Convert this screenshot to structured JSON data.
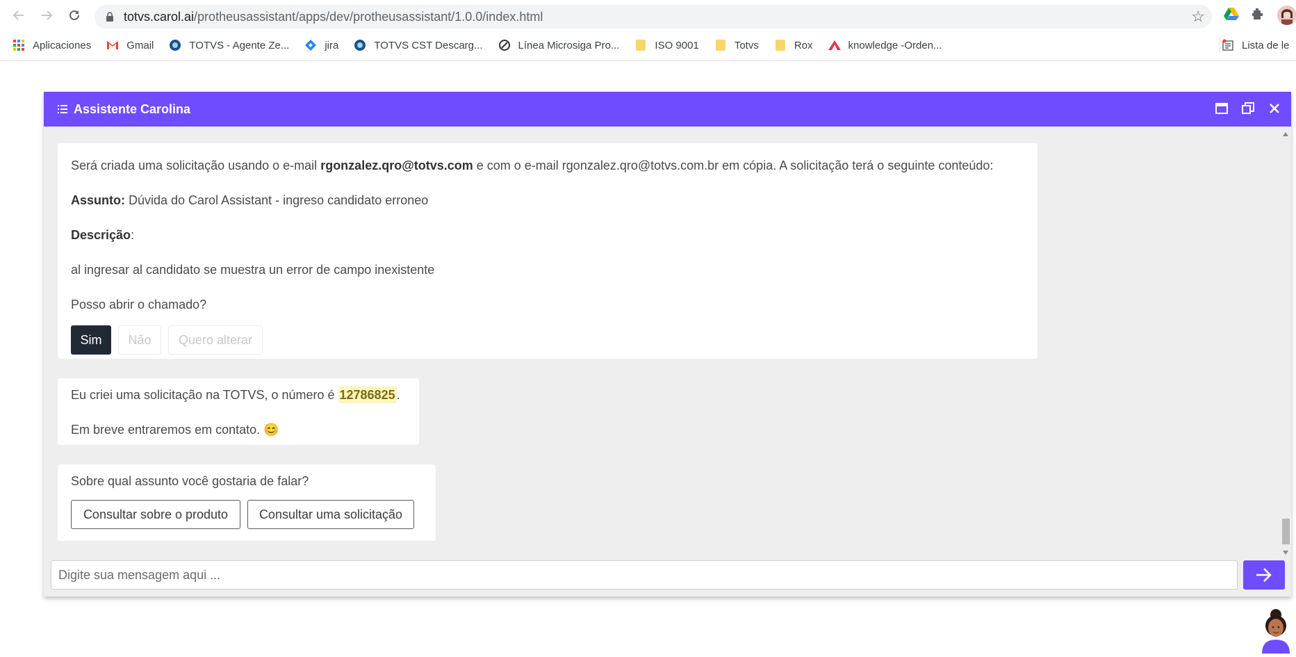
{
  "browser": {
    "url_host": "totvs.carol.ai",
    "url_path": "/protheusassistant/apps/dev/protheusassistant/1.0.0/index.html",
    "bookmarks": [
      {
        "label": "Aplicaciones",
        "icon": "apps-grid-icon"
      },
      {
        "label": "Gmail",
        "icon": "gmail-icon"
      },
      {
        "label": "TOTVS - Agente Ze...",
        "icon": "globe-icon"
      },
      {
        "label": "jira",
        "icon": "jira-icon"
      },
      {
        "label": "TOTVS CST Descarg...",
        "icon": "globe-icon"
      },
      {
        "label": "Línea Microsiga Pro...",
        "icon": "globe-icon"
      },
      {
        "label": "ISO 9001",
        "icon": "folder-icon"
      },
      {
        "label": "Totvs",
        "icon": "folder-icon"
      },
      {
        "label": "Rox",
        "icon": "folder-icon"
      },
      {
        "label": "knowledge -Orden...",
        "icon": "knowledge-icon"
      }
    ],
    "reading_list": "Lista de le"
  },
  "chat": {
    "title": "Assistente Carolina",
    "colors": {
      "accent": "#6f4cff",
      "primary_button": "#212a34",
      "highlight": "#fff6b8"
    },
    "message1": {
      "intro_prefix": "Será criada uma solicitação usando o e-mail ",
      "email": "rgonzalez.qro@totvs.com",
      "intro_suffix": " e com o e-mail rgonzalez.qro@totvs.com.br em cópia. A solicitação terá o seguinte conteúdo:",
      "subject_label": "Assunto:",
      "subject_value": " Dúvida do Carol Assistant - ingreso candidato erroneo",
      "description_label": "Descrição",
      "description_colon": ":",
      "description_value": "al ingresar al candidato se muestra un error de campo inexistente",
      "question": "Posso abrir o chamado?",
      "buttons": {
        "yes": "Sim",
        "no": "Não",
        "change": "Quero alterar"
      }
    },
    "message2": {
      "line1_prefix": "Eu criei uma solicitação na TOTVS, o número é ",
      "ticket_number": "12786825",
      "line1_suffix": ".",
      "line2": "Em breve entraremos em contato. ",
      "emoji": "😊"
    },
    "message3": {
      "question": "Sobre qual assunto você gostaria de falar?",
      "buttons": {
        "product": "Consultar sobre o produto",
        "request": "Consultar uma solicitação"
      }
    },
    "input": {
      "placeholder": "Digite sua mensagem aqui ..."
    }
  }
}
